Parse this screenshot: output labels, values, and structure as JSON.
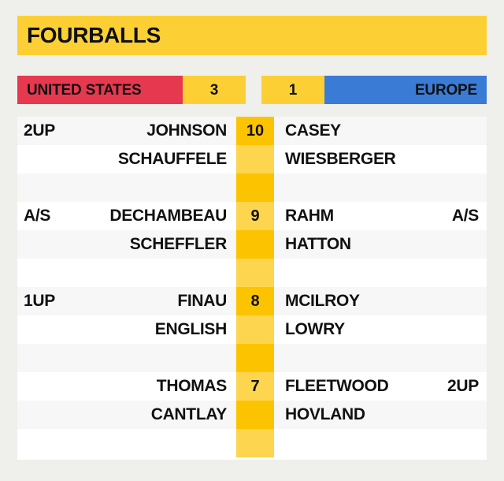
{
  "header": {
    "title": "FOURBALLS"
  },
  "scoreboard": {
    "usa": {
      "name": "UNITED STATES",
      "score": "3",
      "color": "#E63950"
    },
    "europe": {
      "name": "EUROPE",
      "score": "1",
      "color": "#3A7BD5"
    },
    "score_box_color": "#FCD034"
  },
  "theme": {
    "background": "#EFEFEB",
    "accent_yellow": "#FCD034",
    "hole_dark": "#FCC400",
    "hole_light": "#FDD54F",
    "card": "#FFFFFF",
    "row_alt": "#F7F7F7"
  },
  "matches": [
    {
      "status_left": "2UP",
      "status_right": "",
      "hole": "10",
      "usa_players": [
        "JOHNSON",
        "SCHAUFFELE"
      ],
      "europe_players": [
        "CASEY",
        "WIESBERGER"
      ]
    },
    {
      "status_left": "A/S",
      "status_right": "A/S",
      "hole": "9",
      "usa_players": [
        "DECHAMBEAU",
        "SCHEFFLER"
      ],
      "europe_players": [
        "RAHM",
        "HATTON"
      ]
    },
    {
      "status_left": "1UP",
      "status_right": "",
      "hole": "8",
      "usa_players": [
        "FINAU",
        "ENGLISH"
      ],
      "europe_players": [
        "MCILROY",
        "LOWRY"
      ]
    },
    {
      "status_left": "",
      "status_right": "2UP",
      "hole": "7",
      "usa_players": [
        "THOMAS",
        "CANTLAY"
      ],
      "europe_players": [
        "FLEETWOOD",
        "HOVLAND"
      ]
    }
  ]
}
